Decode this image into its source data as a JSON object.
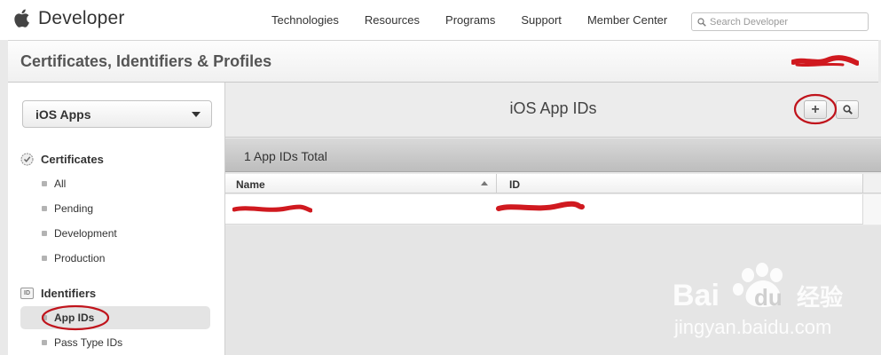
{
  "topnav": {
    "brand": "Developer",
    "links": [
      "Technologies",
      "Resources",
      "Programs",
      "Support",
      "Member Center"
    ],
    "search_placeholder": "Search Developer"
  },
  "header": {
    "title": "Certificates, Identifiers & Profiles"
  },
  "sidebar": {
    "platform_select": "iOS Apps",
    "certificates": {
      "label": "Certificates",
      "items": [
        "All",
        "Pending",
        "Development",
        "Production"
      ]
    },
    "identifiers": {
      "icon_label": "ID",
      "label": "Identifiers",
      "items": [
        "App IDs",
        "Pass Type IDs"
      ]
    }
  },
  "main": {
    "title": "iOS App IDs",
    "add_button": "+",
    "total_text": "1 App IDs Total",
    "table": {
      "columns": [
        "Name",
        "ID"
      ]
    }
  },
  "watermark": {
    "brand_left": "Bai",
    "brand_right": "du",
    "brand_cn": "经验",
    "url": "jingyan.baidu.com"
  },
  "colors": {
    "annotation_red": "#c0141c",
    "accent_gray": "#bdbdbd"
  }
}
